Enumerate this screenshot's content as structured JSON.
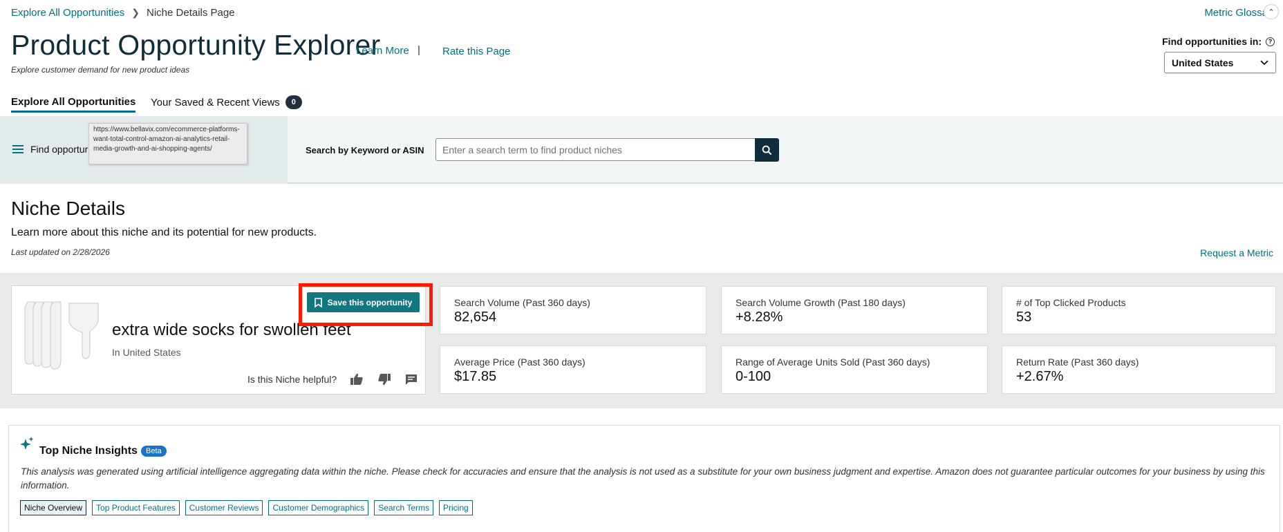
{
  "breadcrumb": {
    "root": "Explore All Opportunities",
    "current": "Niche Details Page"
  },
  "header": {
    "metric_glossary": "Metric Glossa",
    "title": "Product Opportunity Explorer",
    "learn_more": "Learn More",
    "separator": "|",
    "rate_page": "Rate this Page",
    "subtitle": "Explore customer demand for new product ideas",
    "find_in_label": "Find opportunities in:",
    "country": "United States"
  },
  "tabs": {
    "explore": "Explore All Opportunities",
    "saved": "Your Saved & Recent Views",
    "saved_count": "0"
  },
  "search": {
    "filter_label": "Find opportur",
    "tooltip": "https://www.bellavix.com/ecommerce-platforms-want-total-control-amazon-ai-analytics-retail-media-growth-and-ai-shopping-agents/",
    "label": "Search by Keyword or ASIN",
    "placeholder": "Enter a search term to find product niches"
  },
  "niche_details": {
    "title": "Niche Details",
    "description": "Learn more about this niche and its potential for new products.",
    "last_updated": "Last updated on 2/28/2026",
    "request_metric": "Request a Metric"
  },
  "niche": {
    "name": "extra wide socks for swollen feet",
    "region": "In United States",
    "helpful_prompt": "Is this Niche helpful?",
    "save_label": "Save this opportunity"
  },
  "metrics": [
    {
      "label": "Search Volume (Past 360 days)",
      "value": "82,654"
    },
    {
      "label": "Search Volume Growth (Past 180 days)",
      "value": "+8.28%"
    },
    {
      "label": "# of Top Clicked Products",
      "value": "53"
    },
    {
      "label": "Average Price (Past 360 days)",
      "value": "$17.85"
    },
    {
      "label": "Range of Average Units Sold (Past 360 days)",
      "value": "0-100"
    },
    {
      "label": "Return Rate (Past 360 days)",
      "value": "+2.67%"
    }
  ],
  "insights": {
    "title": "Top Niche Insights",
    "badge": "Beta",
    "disclaimer": "This analysis was generated using artificial intelligence aggregating data within the niche. Please check for accuracies and ensure that the analysis is not used as a substitute for your own business judgment and expertise. Amazon does not guarantee particular outcomes for your business by using this information.",
    "chips": [
      "Niche Overview",
      "Top Product Features",
      "Customer Reviews",
      "Customer Demographics",
      "Search Terms",
      "Pricing"
    ]
  },
  "icons": {
    "menu": "hamburger-menu-icon",
    "search": "search-icon",
    "bookmark": "bookmark-icon",
    "thumbs_up": "thumbs-up-icon",
    "thumbs_down": "thumbs-down-icon",
    "comment": "comment-icon",
    "sparkle": "sparkle-icon",
    "help": "help-icon",
    "chevron": "chevron-down-icon"
  },
  "colors": {
    "link": "#007185",
    "accent": "#13777f",
    "highlight": "#ff1a00",
    "dark": "#0f2d3a"
  }
}
